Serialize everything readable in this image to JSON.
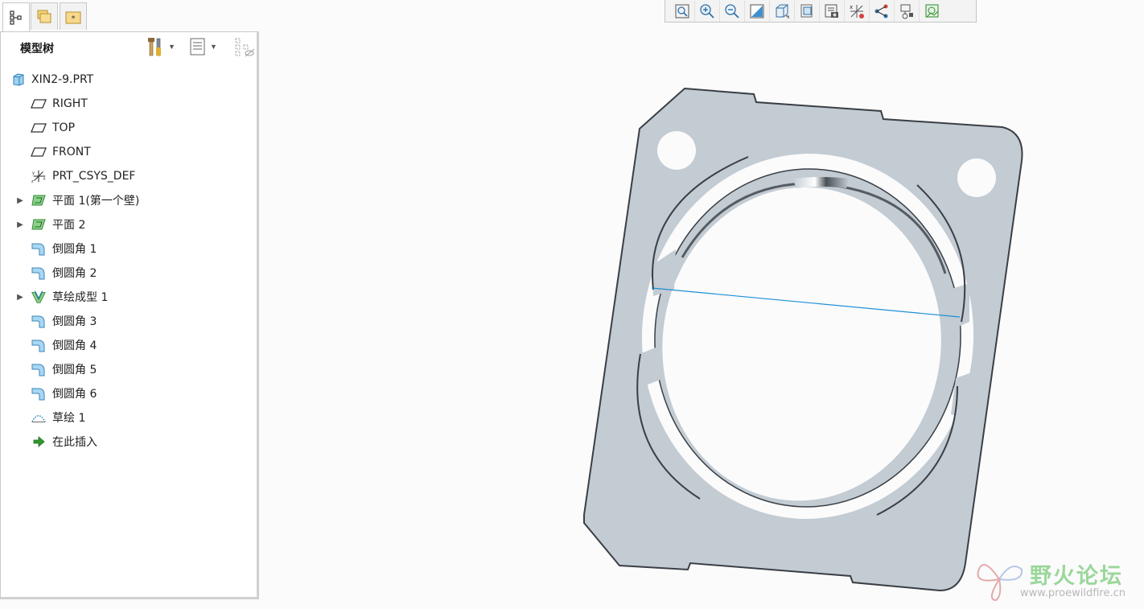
{
  "tabs": [
    {
      "icon": "model-tree-icon",
      "active": true
    },
    {
      "icon": "folder-browser-icon",
      "active": false
    },
    {
      "icon": "favorites-icon",
      "active": false
    }
  ],
  "panel": {
    "title": "模型树",
    "settings_icon": "tools-icon",
    "show_icon": "list-settings-icon",
    "filter_icon": "tree-filter-icon"
  },
  "tree": [
    {
      "label": "XIN2-9.PRT",
      "icon": "part-icon",
      "expandable": false
    },
    {
      "label": "RIGHT",
      "icon": "datum-plane-icon",
      "expandable": false
    },
    {
      "label": "TOP",
      "icon": "datum-plane-icon",
      "expandable": false
    },
    {
      "label": "FRONT",
      "icon": "datum-plane-icon",
      "expandable": false
    },
    {
      "label": "PRT_CSYS_DEF",
      "icon": "csys-icon",
      "expandable": false
    },
    {
      "label": "平面 1(第一个壁)",
      "icon": "flat-wall-icon",
      "expandable": true
    },
    {
      "label": "平面 2",
      "icon": "flat-wall-icon",
      "expandable": true
    },
    {
      "label": "倒圆角 1",
      "icon": "round-icon",
      "expandable": false
    },
    {
      "label": "倒圆角 2",
      "icon": "round-icon",
      "expandable": false
    },
    {
      "label": "草绘成型 1",
      "icon": "sketch-form-icon",
      "expandable": true
    },
    {
      "label": "倒圆角 3",
      "icon": "round-icon",
      "expandable": false
    },
    {
      "label": "倒圆角 4",
      "icon": "round-icon",
      "expandable": false
    },
    {
      "label": "倒圆角 5",
      "icon": "round-icon",
      "expandable": false
    },
    {
      "label": "倒圆角 6",
      "icon": "round-icon",
      "expandable": false
    },
    {
      "label": "草绘 1",
      "icon": "sketch-icon",
      "expandable": false
    },
    {
      "label": "在此插入",
      "icon": "insert-here-icon",
      "expandable": false
    }
  ],
  "toolbar": [
    "refit-icon",
    "zoom-in-icon",
    "zoom-out-icon",
    "repaint-icon",
    "display-style-icon",
    "saved-orientations-icon",
    "view-manager-icon",
    "datum-display-filters-icon",
    "annotation-display-icon",
    "spin-center-icon",
    "appearance-icon"
  ],
  "colors": {
    "part_face": "#c3cbd3",
    "part_edge": "#3a3f45",
    "datum_line": "#1d8fd6",
    "watermark_green": "#9bd79b"
  },
  "watermark": {
    "text": "野火论坛",
    "url": "www.proewildfire.cn"
  }
}
